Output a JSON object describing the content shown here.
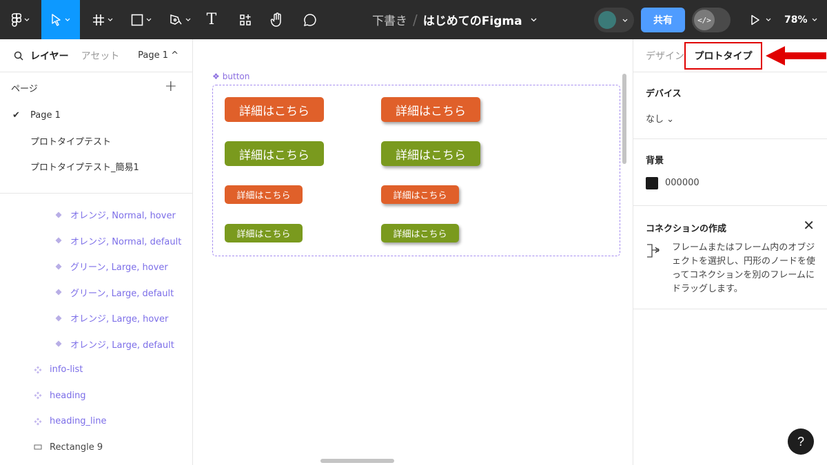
{
  "toolbar": {
    "menu_icon": "figma-logo-icon",
    "move_tool_icon": "cursor-arrow-icon",
    "frame_tool_icon": "frame-hash-icon",
    "shape_tool_icon": "rectangle-icon",
    "pen_tool_icon": "pen-icon",
    "text_tool_label": "T",
    "resources_icon": "resources-icon",
    "hand_tool_icon": "hand-icon",
    "comment_tool_icon": "comment-bubble-icon",
    "draft_label": "下書き",
    "slash": "/",
    "file_name": "はじめてのFigma",
    "share_label": "共有",
    "dev_mode_label": "</>",
    "present_icon": "play-icon",
    "zoom_label": "78%"
  },
  "left_panel": {
    "search_icon": "search-icon",
    "tab_layers": "レイヤー",
    "tab_assets": "アセット",
    "page_selector": "Page 1 ^",
    "pages_header": "ページ",
    "add_page": "+",
    "pages": [
      {
        "name": "Page 1",
        "checked": true
      },
      {
        "name": "プロトタイプテスト",
        "checked": false
      },
      {
        "name": "プロトタイプテスト_簡易1",
        "checked": false
      }
    ],
    "layers": [
      {
        "name": "オレンジ, Normal, hover",
        "icon": "variant-diamond-icon"
      },
      {
        "name": "オレンジ, Normal, default",
        "icon": "variant-diamond-icon"
      },
      {
        "name": "グリーン, Large, hover",
        "icon": "variant-diamond-icon"
      },
      {
        "name": "グリーン, Large, default",
        "icon": "variant-diamond-icon"
      },
      {
        "name": "オレンジ, Large, hover",
        "icon": "variant-diamond-icon"
      },
      {
        "name": "オレンジ, Large, default",
        "icon": "variant-diamond-icon"
      },
      {
        "name": "info-list",
        "icon": "component-set-icon"
      },
      {
        "name": "heading",
        "icon": "component-set-icon"
      },
      {
        "name": "heading_line",
        "icon": "component-set-icon"
      },
      {
        "name": "Rectangle 9",
        "icon": "rectangle-layer-icon"
      }
    ]
  },
  "canvas": {
    "frame_label": "button",
    "frame_icon": "component-set-icon",
    "buttons": [
      {
        "text": "詳細はこちら",
        "color": "#e0602a",
        "size": "large",
        "state": "default"
      },
      {
        "text": "詳細はこちら",
        "color": "#e0602a",
        "size": "large",
        "state": "hover"
      },
      {
        "text": "詳細はこちら",
        "color": "#7a9a1e",
        "size": "large",
        "state": "default"
      },
      {
        "text": "詳細はこちら",
        "color": "#7a9a1e",
        "size": "large",
        "state": "hover"
      },
      {
        "text": "詳細はこちら",
        "color": "#e0602a",
        "size": "normal",
        "state": "default"
      },
      {
        "text": "詳細はこちら",
        "color": "#e0602a",
        "size": "normal",
        "state": "hover"
      },
      {
        "text": "詳細はこちら",
        "color": "#7a9a1e",
        "size": "normal",
        "state": "default"
      },
      {
        "text": "詳細はこちら",
        "color": "#7a9a1e",
        "size": "normal",
        "state": "hover"
      }
    ]
  },
  "right_panel": {
    "tab_design": "デザイン",
    "tab_prototype": "プロトタイプ",
    "highlight_color": "#e00000",
    "device_title": "デバイス",
    "device_value": "なし ⌄",
    "background_title": "背景",
    "background_swatch": "#1a1a1a",
    "background_value": "000000",
    "connection_title": "コネクションの作成",
    "connection_close": "✕",
    "connection_icon": "connection-node-icon",
    "connection_text": "フレームまたはフレーム内のオブジェクトを選択し、円形のノードを使ってコネクションを別のフレームにドラッグします。"
  },
  "help_label": "?"
}
